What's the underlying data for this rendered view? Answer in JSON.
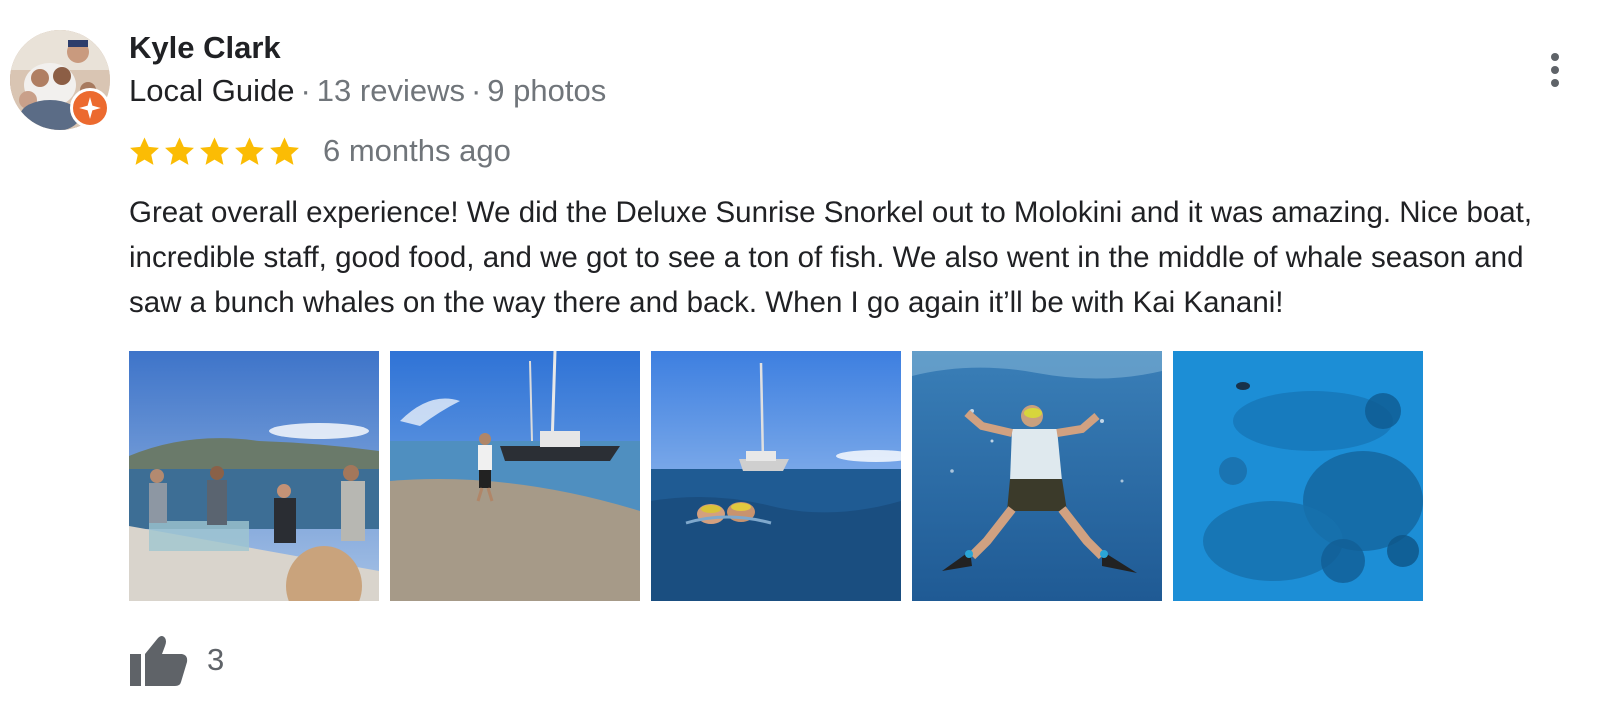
{
  "reviewer": {
    "name": "Kyle Clark",
    "badge": "Local Guide",
    "separator": "·",
    "reviews": "13 reviews",
    "photos": "9 photos"
  },
  "rating": {
    "stars": 5,
    "max_stars": 5,
    "date": "6 months ago"
  },
  "review": {
    "text": "Great overall experience! We did the Deluxe Sunrise Snorkel out to Molokini and it was amazing. Nice boat, incredible staff, good food, and we got to see a ton of fish. We also went in the middle of whale season and saw a bunch whales on the way there and back. When I go again it’ll be with Kai Kanani!"
  },
  "photos": [
    {
      "subject": "people-on-boat-deck-photo"
    },
    {
      "subject": "catamaran-at-beach-photo"
    },
    {
      "subject": "swimmers-near-catamaran-photo"
    },
    {
      "subject": "underwater-snorkeler-photo"
    },
    {
      "subject": "coral-reef-photo"
    }
  ],
  "likes": {
    "count": "3",
    "icon": "thumbs-up-icon"
  },
  "colors": {
    "star": "#fbbc04",
    "badge": "#ec6a2f",
    "text_primary": "#202124",
    "text_secondary": "#70757a"
  }
}
